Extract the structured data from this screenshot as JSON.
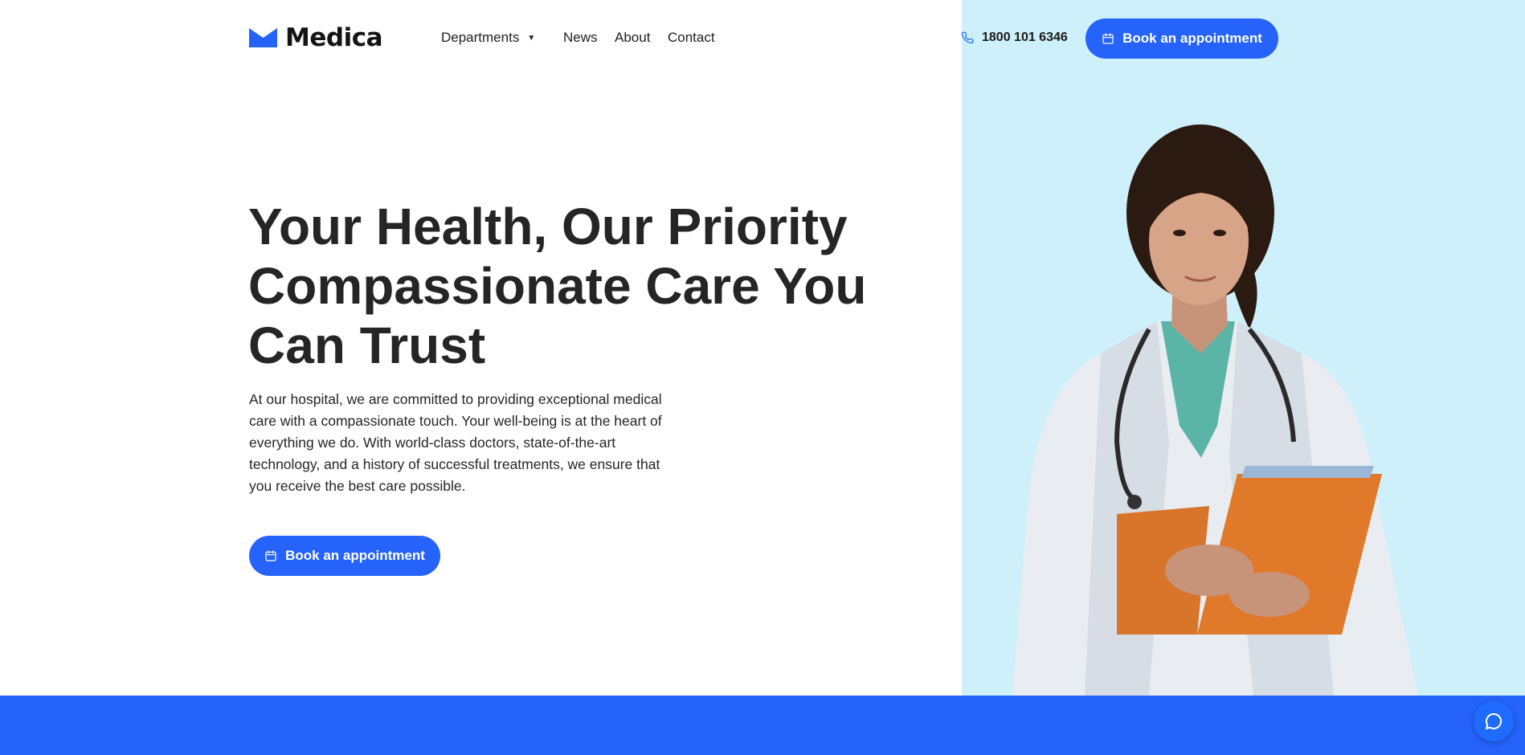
{
  "brand": {
    "name": "Medica",
    "accent_color": "#2563fb",
    "panel_color": "#cdf0fa"
  },
  "header": {
    "nav": {
      "departments": "Departments",
      "news": "News",
      "about": "About",
      "contact": "Contact"
    },
    "phone": "1800 101 6346",
    "cta_label": "Book an appointment"
  },
  "hero": {
    "title_lines": [
      "Your Health, Our Priority",
      "Compassionate Care You",
      "Can Trust"
    ],
    "description": "At our hospital, we are committed to providing exceptional medical care with a compassionate touch. Your well-being is at the heart of everything we do. With world-class doctors, state-of-the-art technology, and a history of successful treatments, we ensure that you receive the best care possible.",
    "cta_label": "Book an appointment"
  },
  "icons": {
    "logo": "logo-mark-icon",
    "dropdown": "caret-down-icon",
    "phone": "phone-icon",
    "calendar": "calendar-icon",
    "chat": "chat-bubble-icon"
  }
}
